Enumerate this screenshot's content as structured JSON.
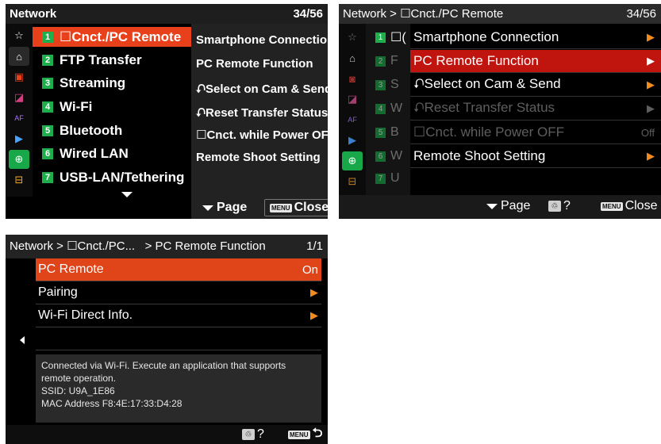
{
  "screen1": {
    "title": "Network",
    "page": "34/56",
    "icons": [
      "star-icon",
      "home-camera-icon",
      "camera-settings-icon",
      "exposure-icon",
      "af-mf-icon",
      "playback-icon",
      "network-icon",
      "toolbox-icon"
    ],
    "menu": [
      {
        "num": "1",
        "label": "☐Cnct./PC Remote"
      },
      {
        "num": "2",
        "label": "FTP Transfer"
      },
      {
        "num": "3",
        "label": "Streaming"
      },
      {
        "num": "4",
        "label": "Wi-Fi"
      },
      {
        "num": "5",
        "label": "Bluetooth"
      },
      {
        "num": "6",
        "label": "Wired LAN"
      },
      {
        "num": "7",
        "label": "USB-LAN/Tethering"
      }
    ],
    "submenu": [
      "Smartphone Connection",
      "PC Remote Function",
      "⮏Select on Cam & Send",
      "⮏Reset Transfer Status",
      "☐Cnct. while Power OFF",
      "Remote Shoot Setting"
    ],
    "footer": {
      "page_label": "Page",
      "menu_chip": "MENU",
      "close_label": "Close"
    }
  },
  "screen2": {
    "title": "Network > ☐Cnct./PC Remote",
    "page": "34/56",
    "left_column": [
      {
        "num": "1",
        "text": "☐("
      },
      {
        "num": "2",
        "text": "F"
      },
      {
        "num": "3",
        "text": "S"
      },
      {
        "num": "4",
        "text": "W"
      },
      {
        "num": "5",
        "text": "B"
      },
      {
        "num": "6",
        "text": "W"
      },
      {
        "num": "7",
        "text": "U"
      }
    ],
    "items": [
      {
        "label": "Smartphone Connection",
        "value": "▶"
      },
      {
        "label": "PC Remote Function",
        "value": "▶"
      },
      {
        "label": "⮏Select on Cam & Send",
        "value": "▶"
      },
      {
        "label": "⮏Reset Transfer Status",
        "value": "▶"
      },
      {
        "label": "☐Cnct. while Power OFF",
        "value": "Off"
      },
      {
        "label": "Remote Shoot Setting",
        "value": "▶"
      }
    ],
    "footer": {
      "page_label": "Page",
      "help": "?",
      "trash_chip": "♲",
      "menu_chip": "MENU",
      "close_label": "Close"
    }
  },
  "screen3": {
    "title": "Network > ☐Cnct./PC...   > PC Remote Function",
    "page": "1/1",
    "items": [
      {
        "label": "PC Remote",
        "value": "On"
      },
      {
        "label": "Pairing",
        "value": "▶"
      },
      {
        "label": "Wi-Fi Direct Info.",
        "value": "▶"
      }
    ],
    "info": {
      "line1": "Connected via Wi-Fi. Execute an application that supports",
      "line2": "remote operation.",
      "line3": "SSID: U9A_1E86",
      "line4": "MAC Address F8:4E:17:33:D4:28"
    },
    "footer": {
      "help": "?",
      "trash_chip": "♲",
      "menu_chip": "MENU",
      "return": "⮌"
    }
  }
}
